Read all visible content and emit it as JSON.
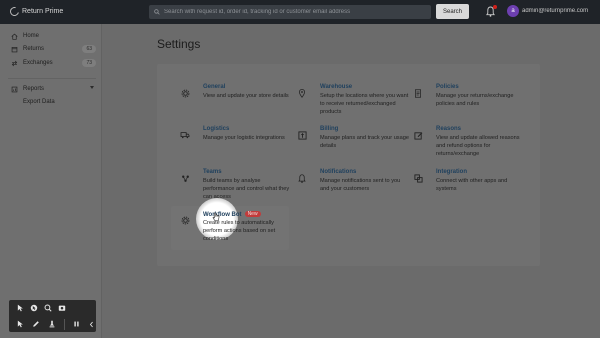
{
  "app": {
    "name": "Return Prime"
  },
  "search": {
    "placeholder": "Search with request id, order id, tracking id or customer email address",
    "button_label": "Search"
  },
  "user": {
    "initial": "a",
    "email": "admin@returnprime.com"
  },
  "sidebar": {
    "items": [
      {
        "label": "Home",
        "icon": "home-icon"
      },
      {
        "label": "Returns",
        "icon": "returns-icon",
        "count": "63"
      },
      {
        "label": "Exchanges",
        "icon": "exchange-icon",
        "count": "73"
      },
      {
        "label": "Reports",
        "icon": "reports-icon"
      },
      {
        "label": "Export Data",
        "icon": "export-icon"
      }
    ]
  },
  "page": {
    "title": "Settings"
  },
  "settings": [
    {
      "title": "General",
      "desc": "View and update your store details",
      "icon": "gear-icon"
    },
    {
      "title": "Warehouse",
      "desc": "Setup the locations where you want to receive returned/exchanged products",
      "icon": "location-icon"
    },
    {
      "title": "Policies",
      "desc": "Manage your returns/exchange policies and rules",
      "icon": "document-icon"
    },
    {
      "title": "Logistics",
      "desc": "Manage your logistic integrations",
      "icon": "truck-icon"
    },
    {
      "title": "Billing",
      "desc": "Manage plans and track your usage details",
      "icon": "billing-icon"
    },
    {
      "title": "Reasons",
      "desc": "View and update allowed reasons and refund options for returns/exchange",
      "icon": "edit-icon"
    },
    {
      "title": "Teams",
      "desc": "Build teams by analyse performance and control what they can access",
      "icon": "team-icon"
    },
    {
      "title": "Notifications",
      "desc": "Manage notifications sent to you and your customers",
      "icon": "bell-icon"
    },
    {
      "title": "Integration",
      "desc": "Connect with other apps and systems",
      "icon": "integration-icon"
    },
    {
      "title": "Workflow Bot",
      "badge": "New",
      "desc": "Create rules to automatically perform actions based on set conditions",
      "icon": "gear-icon"
    }
  ],
  "colors": {
    "topbar": "#1f2328",
    "badge": "#c23b3b",
    "link": "#20415e"
  }
}
